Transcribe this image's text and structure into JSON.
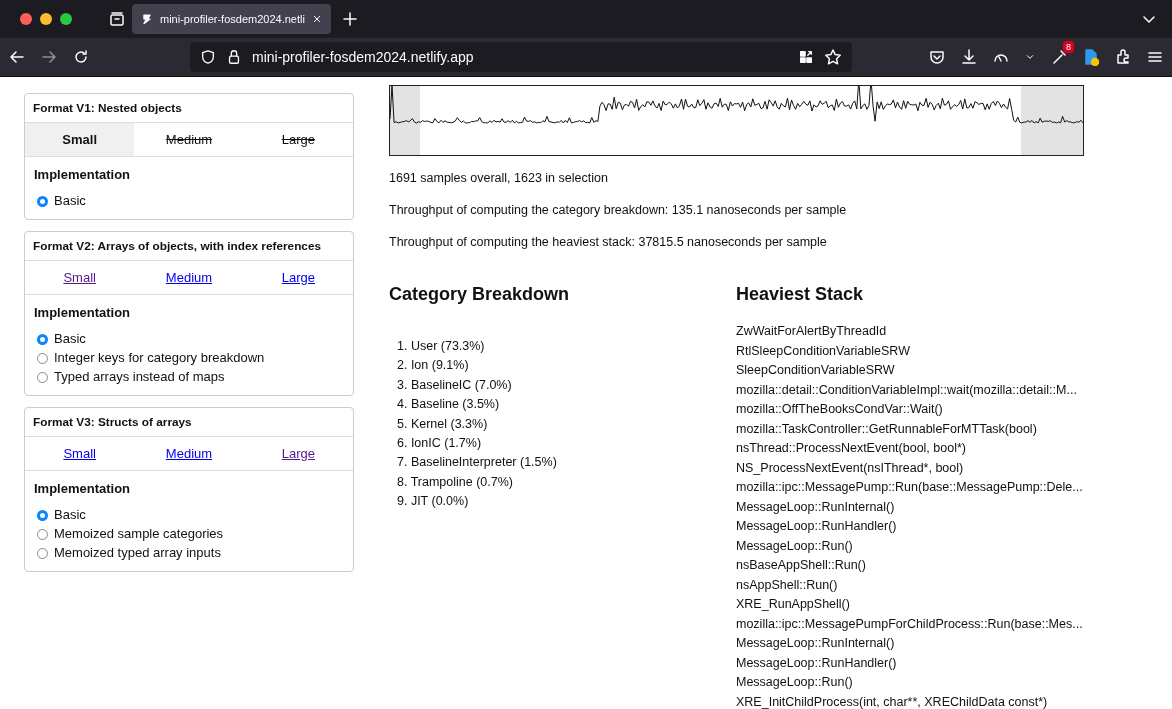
{
  "browser": {
    "tab": {
      "title": "mini-profiler-fosdem2024.netli"
    },
    "url": "mini-profiler-fosdem2024.netlify.app",
    "extension_badge": "8"
  },
  "formats": [
    {
      "title": "Format V1: Nested objects",
      "sizes": [
        {
          "label": "Small",
          "selected": true,
          "disabled": false
        },
        {
          "label": "Medium",
          "selected": false,
          "disabled": true
        },
        {
          "label": "Large",
          "selected": false,
          "disabled": true
        }
      ],
      "implementation_title": "Implementation",
      "options": [
        {
          "label": "Basic",
          "selected": true
        }
      ]
    },
    {
      "title": "Format V2: Arrays of objects, with index references",
      "sizes": [
        {
          "label": "Small",
          "selected": false,
          "disabled": false,
          "visited": true
        },
        {
          "label": "Medium",
          "selected": false,
          "disabled": false,
          "visited": false
        },
        {
          "label": "Large",
          "selected": false,
          "disabled": false,
          "visited": false
        }
      ],
      "implementation_title": "Implementation",
      "options": [
        {
          "label": "Basic",
          "selected": true
        },
        {
          "label": "Integer keys for category breakdown",
          "selected": false
        },
        {
          "label": "Typed arrays instead of maps",
          "selected": false
        }
      ]
    },
    {
      "title": "Format V3: Structs of arrays",
      "sizes": [
        {
          "label": "Small",
          "selected": false,
          "disabled": false,
          "visited": false
        },
        {
          "label": "Medium",
          "selected": false,
          "disabled": false,
          "visited": false
        },
        {
          "label": "Large",
          "selected": false,
          "disabled": false,
          "visited": true
        }
      ],
      "implementation_title": "Implementation",
      "options": [
        {
          "label": "Basic",
          "selected": true
        },
        {
          "label": "Memoized sample categories",
          "selected": false
        },
        {
          "label": "Memoized typed array inputs",
          "selected": false
        }
      ]
    }
  ],
  "stats": [
    "1691 samples overall, 1623 in selection",
    "Throughput of computing the category breakdown: 135.1 nanoseconds per sample",
    "Throughput of computing the heaviest stack: 37815.5 nanoseconds per sample"
  ],
  "category_breakdown": {
    "title": "Category Breakdown",
    "items": [
      "1. User (73.3%)",
      "2. Ion (9.1%)",
      "3. BaselineIC (7.0%)",
      "4. Baseline (3.5%)",
      "5. Kernel (3.3%)",
      "6. IonIC (1.7%)",
      "7. BaselineInterpreter (1.5%)",
      "8. Trampoline (0.7%)",
      "9. JIT (0.0%)"
    ]
  },
  "heaviest_stack": {
    "title": "Heaviest Stack",
    "frames": [
      "ZwWaitForAlertByThreadId",
      "RtlSleepConditionVariableSRW",
      "SleepConditionVariableSRW",
      "mozilla::detail::ConditionVariableImpl::wait(mozilla::detail::M...",
      "mozilla::OffTheBooksCondVar::Wait()",
      "mozilla::TaskController::GetRunnableForMTTask(bool)",
      "nsThread::ProcessNextEvent(bool, bool*)",
      "NS_ProcessNextEvent(nsIThread*, bool)",
      "mozilla::ipc::MessagePump::Run(base::MessagePump::Dele...",
      "MessageLoop::RunInternal()",
      "MessageLoop::RunHandler()",
      "MessageLoop::Run()",
      "nsBaseAppShell::Run()",
      "nsAppShell::Run()",
      "XRE_RunAppShell()",
      "mozilla::ipc::MessagePumpForChildProcess::Run(base::Mes...",
      "MessageLoop::RunInternal()",
      "MessageLoop::RunHandler()",
      "MessageLoop::Run()",
      "XRE_InitChildProcess(int, char**, XREChildData const*)"
    ]
  }
}
